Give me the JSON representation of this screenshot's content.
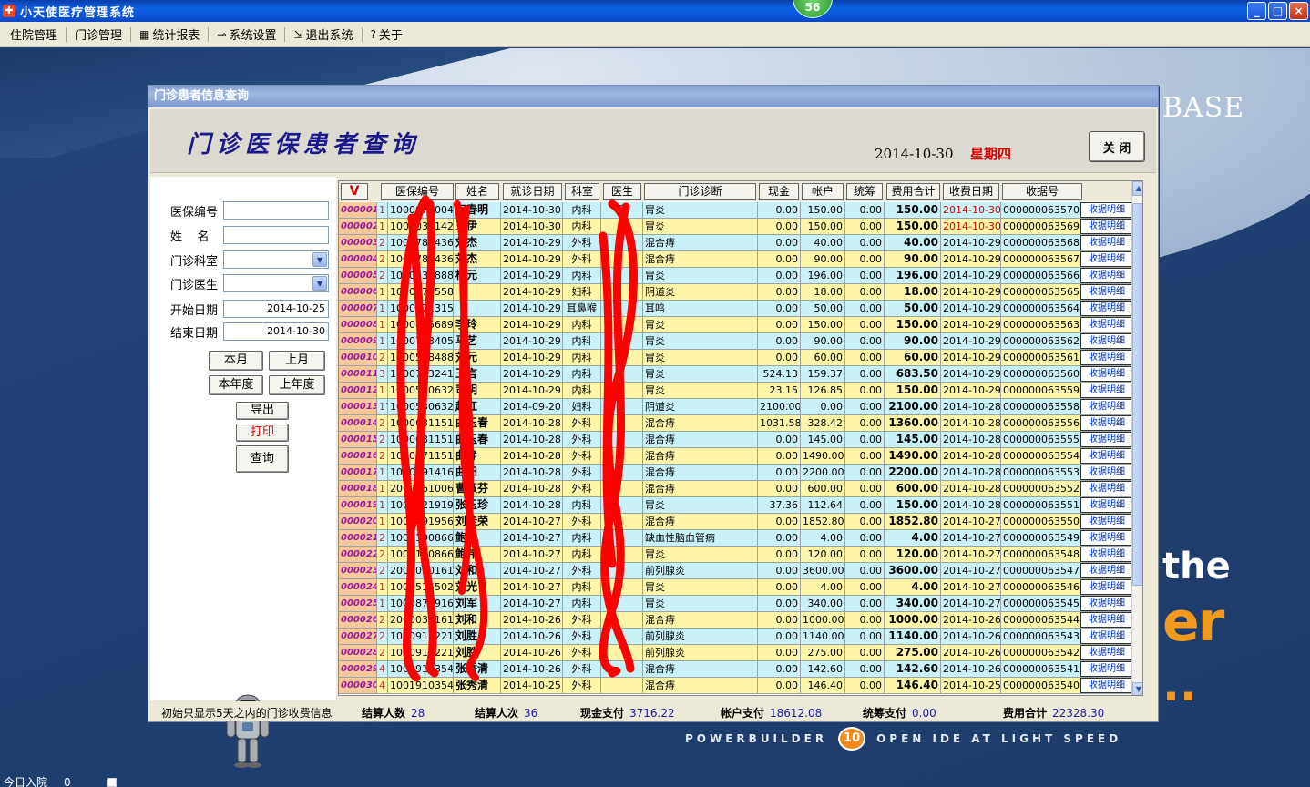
{
  "window": {
    "title": "小天使医疗管理系统",
    "badge": "56",
    "buttons": {
      "minimize": "_",
      "maximize": "□",
      "close": "×"
    }
  },
  "menu": [
    {
      "label": "住院管理",
      "icon": ""
    },
    {
      "label": "门诊管理",
      "icon": ""
    },
    {
      "label": "统计报表",
      "icon": "report-icon"
    },
    {
      "label": "系统设置",
      "icon": "key-icon"
    },
    {
      "label": "退出系统",
      "icon": "exit-icon"
    },
    {
      "label": "关于",
      "icon": "help-icon"
    }
  ],
  "background": {
    "brand_base": "BASE",
    "brand_the": "the",
    "brand_er": "er",
    "brand_dots": "..",
    "tagline_left": "POWERBUILDER",
    "tagline_badge": "10",
    "tagline_right": "OPEN IDE AT LIGHT SPEED"
  },
  "bottom_status": {
    "label": "今日入院",
    "value": "0"
  },
  "dialog": {
    "title": "门诊患者信息查询",
    "heading": "门诊医保患者查询",
    "date": "2014-10-30",
    "weekday": "星期四",
    "close_label": "关 闭"
  },
  "search": {
    "insurance_no_label": "医保编号",
    "insurance_no_value": "",
    "name_label": "姓    名",
    "name_value": "",
    "dept_label": "门诊科室",
    "dept_value": "",
    "doctor_label": "门诊医生",
    "doctor_value": "",
    "start_label": "开始日期",
    "start_value": "2014-10-25",
    "end_label": "结束日期",
    "end_value": "2014-10-30",
    "btn_this_month": "本月",
    "btn_last_month": "上月",
    "btn_this_year": "本年度",
    "btn_last_year": "上年度",
    "btn_export": "导出",
    "btn_print": "打印",
    "btn_query": "查询"
  },
  "grid": {
    "sort_label": "V",
    "columns": [
      "医保编号",
      "姓名",
      "就诊日期",
      "科室",
      "医生",
      "门诊诊断",
      "现金",
      "帐户",
      "统筹",
      "费用合计",
      "收费日期",
      "收据号"
    ],
    "detail_label": "收据明细",
    "rows": [
      {
        "n": "000001",
        "t": "1",
        "id": "1000071004",
        "name": "何春明",
        "date": "2014-10-30",
        "dept": "内科",
        "doc": "医",
        "diag": "胃炎",
        "cash": "0.00",
        "acct": "150.00",
        "pool": "0.00",
        "total": "150.00",
        "paydate": "2014-10-30",
        "receipt": "000000063570",
        "red": true
      },
      {
        "n": "000002",
        "t": "1",
        "id": "1001031142",
        "name": "王伊",
        "date": "2014-10-30",
        "dept": "内科",
        "doc": "",
        "diag": "胃炎",
        "cash": "0.00",
        "acct": "150.00",
        "pool": "0.00",
        "total": "150.00",
        "paydate": "2014-10-30",
        "receipt": "000000063569",
        "red": true
      },
      {
        "n": "000003",
        "t": "2",
        "id": "1000781436",
        "name": "刘杰",
        "date": "2014-10-29",
        "dept": "外科",
        "doc": "",
        "diag": "混合痔",
        "cash": "0.00",
        "acct": "40.00",
        "pool": "0.00",
        "total": "40.00",
        "paydate": "2014-10-29",
        "receipt": "000000063568"
      },
      {
        "n": "000004",
        "t": "2",
        "id": "1000781436",
        "name": "刘杰",
        "date": "2014-10-29",
        "dept": "外科",
        "doc": "",
        "diag": "混合痔",
        "cash": "0.00",
        "acct": "90.00",
        "pool": "0.00",
        "total": "90.00",
        "paydate": "2014-10-29",
        "receipt": "000000063567"
      },
      {
        "n": "000005",
        "t": "2",
        "id": "1000531888",
        "name": "杨元",
        "date": "2014-10-29",
        "dept": "内科",
        "doc": "",
        "diag": "胃炎",
        "cash": "0.00",
        "acct": "196.00",
        "pool": "0.00",
        "total": "196.00",
        "paydate": "2014-10-29",
        "receipt": "000000063566"
      },
      {
        "n": "000006",
        "t": "1",
        "id": "1000871558",
        "name": "",
        "date": "2014-10-29",
        "dept": "妇科",
        "doc": "",
        "diag": "阴道炎",
        "cash": "0.00",
        "acct": "18.00",
        "pool": "0.00",
        "total": "18.00",
        "paydate": "2014-10-29",
        "receipt": "000000063565"
      },
      {
        "n": "000007",
        "t": "1",
        "id": "1000771315",
        "name": "",
        "date": "2014-10-29",
        "dept": "耳鼻喉",
        "doc": "",
        "diag": "耳鸣",
        "cash": "0.00",
        "acct": "50.00",
        "pool": "0.00",
        "total": "50.00",
        "paydate": "2014-10-29",
        "receipt": "000000063564"
      },
      {
        "n": "000008",
        "t": "1",
        "id": "1000875689",
        "name": "李玲",
        "date": "2014-10-29",
        "dept": "内科",
        "doc": "",
        "diag": "胃炎",
        "cash": "0.00",
        "acct": "150.00",
        "pool": "0.00",
        "total": "150.00",
        "paydate": "2014-10-29",
        "receipt": "000000063563"
      },
      {
        "n": "000009",
        "t": "1",
        "id": "1000713405",
        "name": "马艺",
        "date": "2014-10-29",
        "dept": "内科",
        "doc": "",
        "diag": "胃炎",
        "cash": "0.00",
        "acct": "90.00",
        "pool": "0.00",
        "total": "90.00",
        "paydate": "2014-10-29",
        "receipt": "000000063562"
      },
      {
        "n": "000010",
        "t": "2",
        "id": "1000518488",
        "name": "刘元",
        "date": "2014-10-29",
        "dept": "内科",
        "doc": "",
        "diag": "胃炎",
        "cash": "0.00",
        "acct": "60.00",
        "pool": "0.00",
        "total": "60.00",
        "paydate": "2014-10-29",
        "receipt": "000000063561"
      },
      {
        "n": "000011",
        "t": "3",
        "id": "1000713241",
        "name": "王言",
        "date": "2014-10-29",
        "dept": "内科",
        "doc": "",
        "diag": "胃炎",
        "cash": "524.13",
        "acct": "159.37",
        "pool": "0.00",
        "total": "683.50",
        "paydate": "2014-10-29",
        "receipt": "000000063560"
      },
      {
        "n": "000012",
        "t": "1",
        "id": "1000530632",
        "name": "司明",
        "date": "2014-10-29",
        "dept": "内科",
        "doc": "",
        "diag": "胃炎",
        "cash": "23.15",
        "acct": "126.85",
        "pool": "0.00",
        "total": "150.00",
        "paydate": "2014-10-29",
        "receipt": "000000063559"
      },
      {
        "n": "000013",
        "t": "17",
        "id": "1000530632",
        "name": "赵红",
        "date": "2014-09-20",
        "dept": "妇科",
        "doc": "",
        "diag": "阴道炎",
        "cash": "2100.00",
        "acct": "0.00",
        "pool": "0.00",
        "total": "2100.00",
        "paydate": "2014-10-28",
        "receipt": "000000063558"
      },
      {
        "n": "000014",
        "t": "2",
        "id": "1000631151",
        "name": "曲玉春",
        "date": "2014-10-28",
        "dept": "外科",
        "doc": "",
        "diag": "混合痔",
        "cash": "1031.58",
        "acct": "328.42",
        "pool": "0.00",
        "total": "1360.00",
        "paydate": "2014-10-28",
        "receipt": "000000063556"
      },
      {
        "n": "000015",
        "t": "2",
        "id": "1000631151",
        "name": "曲玉春",
        "date": "2014-10-28",
        "dept": "外科",
        "doc": "",
        "diag": "混合痔",
        "cash": "0.00",
        "acct": "145.00",
        "pool": "0.00",
        "total": "145.00",
        "paydate": "2014-10-28",
        "receipt": "000000063555"
      },
      {
        "n": "000016",
        "t": "2",
        "id": "1000671151",
        "name": "曲静",
        "date": "2014-10-28",
        "dept": "外科",
        "doc": "",
        "diag": "混合痔",
        "cash": "0.00",
        "acct": "1490.00",
        "pool": "0.00",
        "total": "1490.00",
        "paydate": "2014-10-28",
        "receipt": "000000063554"
      },
      {
        "n": "000017",
        "t": "1",
        "id": "1000491416",
        "name": "曲阳",
        "date": "2014-10-28",
        "dept": "外科",
        "doc": "",
        "diag": "混合痔",
        "cash": "0.00",
        "acct": "2200.00",
        "pool": "0.00",
        "total": "2200.00",
        "paydate": "2014-10-28",
        "receipt": "000000063553"
      },
      {
        "n": "000018",
        "t": "1",
        "id": "2000161006",
        "name": "曹淑芬",
        "date": "2014-10-28",
        "dept": "外科",
        "doc": "",
        "diag": "混合痔",
        "cash": "0.00",
        "acct": "600.00",
        "pool": "0.00",
        "total": "600.00",
        "paydate": "2014-10-28",
        "receipt": "000000063552"
      },
      {
        "n": "000019",
        "t": "1",
        "id": "1000321919",
        "name": "张玉珍",
        "date": "2014-10-28",
        "dept": "内科",
        "doc": "",
        "diag": "胃炎",
        "cash": "37.36",
        "acct": "112.64",
        "pool": "0.00",
        "total": "150.00",
        "paydate": "2014-10-28",
        "receipt": "000000063551"
      },
      {
        "n": "000020",
        "t": "1",
        "id": "1000891956",
        "name": "刘桂荣",
        "date": "2014-10-27",
        "dept": "外科",
        "doc": "",
        "diag": "混合痔",
        "cash": "0.00",
        "acct": "1852.80",
        "pool": "0.00",
        "total": "1852.80",
        "paydate": "2014-10-27",
        "receipt": "000000063550"
      },
      {
        "n": "000021",
        "t": "2",
        "id": "1000190866",
        "name": "鲍伟",
        "date": "2014-10-27",
        "dept": "内科",
        "doc": "",
        "diag": "缺血性脑血管病",
        "cash": "0.00",
        "acct": "4.00",
        "pool": "0.00",
        "total": "4.00",
        "paydate": "2014-10-27",
        "receipt": "000000063549"
      },
      {
        "n": "000022",
        "t": "2",
        "id": "1000190866",
        "name": "鲍伟",
        "date": "2014-10-27",
        "dept": "内科",
        "doc": "",
        "diag": "胃炎",
        "cash": "0.00",
        "acct": "120.00",
        "pool": "0.00",
        "total": "120.00",
        "paydate": "2014-10-27",
        "receipt": "000000063548"
      },
      {
        "n": "000023",
        "t": "2",
        "id": "2000030161",
        "name": "刘和",
        "date": "2014-10-27",
        "dept": "外科",
        "doc": "",
        "diag": "前列腺炎",
        "cash": "0.00",
        "acct": "3600.00",
        "pool": "0.00",
        "total": "3600.00",
        "paydate": "2014-10-27",
        "receipt": "000000063547"
      },
      {
        "n": "000024",
        "t": "1",
        "id": "1000515502",
        "name": "刘光",
        "date": "2014-10-27",
        "dept": "内科",
        "doc": "",
        "diag": "胃炎",
        "cash": "0.00",
        "acct": "4.00",
        "pool": "0.00",
        "total": "4.00",
        "paydate": "2014-10-27",
        "receipt": "000000063546"
      },
      {
        "n": "000025",
        "t": "1",
        "id": "1000873916",
        "name": "刘军",
        "date": "2014-10-27",
        "dept": "内科",
        "doc": "",
        "diag": "胃炎",
        "cash": "0.00",
        "acct": "340.00",
        "pool": "0.00",
        "total": "340.00",
        "paydate": "2014-10-27",
        "receipt": "000000063545"
      },
      {
        "n": "000026",
        "t": "2",
        "id": "2000030161",
        "name": "刘和",
        "date": "2014-10-26",
        "dept": "外科",
        "doc": "",
        "diag": "混合痔",
        "cash": "0.00",
        "acct": "1000.00",
        "pool": "0.00",
        "total": "1000.00",
        "paydate": "2014-10-26",
        "receipt": "000000063544"
      },
      {
        "n": "000027",
        "t": "2",
        "id": "1000911221",
        "name": "刘胜",
        "date": "2014-10-26",
        "dept": "外科",
        "doc": "",
        "diag": "前列腺炎",
        "cash": "0.00",
        "acct": "1140.00",
        "pool": "0.00",
        "total": "1140.00",
        "paydate": "2014-10-26",
        "receipt": "000000063543"
      },
      {
        "n": "000028",
        "t": "2",
        "id": "1000911221",
        "name": "刘胜",
        "date": "2014-10-26",
        "dept": "外科",
        "doc": "",
        "diag": "前列腺炎",
        "cash": "0.00",
        "acct": "275.00",
        "pool": "0.00",
        "total": "275.00",
        "paydate": "2014-10-26",
        "receipt": "000000063542"
      },
      {
        "n": "000029",
        "t": "4",
        "id": "1000910354",
        "name": "张秀清",
        "date": "2014-10-26",
        "dept": "外科",
        "doc": "",
        "diag": "混合痔",
        "cash": "0.00",
        "acct": "142.60",
        "pool": "0.00",
        "total": "142.60",
        "paydate": "2014-10-26",
        "receipt": "000000063541"
      },
      {
        "n": "000030",
        "t": "4",
        "id": "1001910354",
        "name": "张秀清",
        "date": "2014-10-25",
        "dept": "外科",
        "doc": "",
        "diag": "混合痔",
        "cash": "0.00",
        "acct": "146.40",
        "pool": "0.00",
        "total": "146.40",
        "paydate": "2014-10-25",
        "receipt": "000000063540"
      }
    ]
  },
  "summary": {
    "note": "初始只显示5天之内的门诊收费信息",
    "count_label": "结算人数",
    "count_value": "28",
    "times_label": "结算人次",
    "times_value": "36",
    "cash_label": "现金支付",
    "cash_value": "3716.22",
    "acct_label": "帐户支付",
    "acct_value": "18612.08",
    "pool_label": "统筹支付",
    "pool_value": "0.00",
    "total_label": "费用合计",
    "total_value": "22328.30"
  },
  "colors": {
    "row_cyan": "#c8f2f8",
    "row_yellow": "#fff5a8",
    "rownum": "#f7c99a",
    "redact": "#ff0000"
  }
}
